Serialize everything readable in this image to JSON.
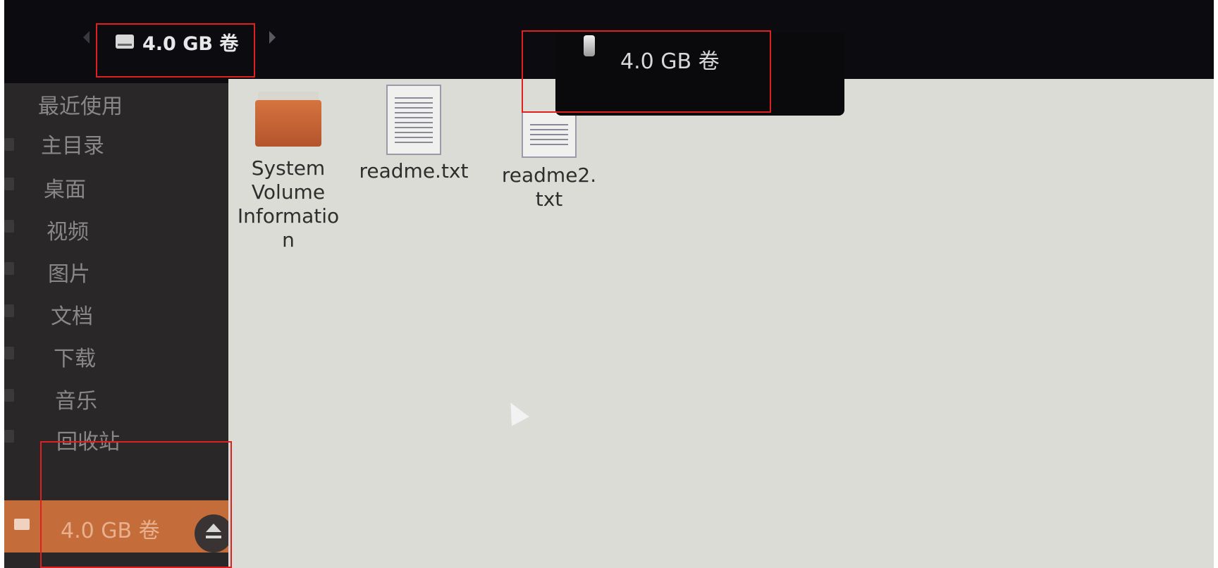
{
  "window": {
    "title": "4.0 GB 卷"
  },
  "header": {
    "path_label": "4.0 GB 卷"
  },
  "tooltip": {
    "label": "4.0 GB 卷"
  },
  "sidebar": {
    "items": [
      {
        "label": "最近使用"
      },
      {
        "label": "主目录"
      },
      {
        "label": "桌面"
      },
      {
        "label": "视频"
      },
      {
        "label": "图片"
      },
      {
        "label": "文档"
      },
      {
        "label": "下载"
      },
      {
        "label": "音乐"
      },
      {
        "label": "回收站"
      }
    ],
    "drive": {
      "label": "4.0 GB 卷",
      "selected": true
    }
  },
  "files": [
    {
      "name": "System Volume Informatio n",
      "type": "folder"
    },
    {
      "name": "readme.txt",
      "type": "text"
    },
    {
      "name": "readme2. txt",
      "type": "text"
    }
  ],
  "colors": {
    "accent": "#c46d3a",
    "annotation": "#e02020",
    "content_bg": "#dcdcd6",
    "sidebar_bg": "#2a2728"
  },
  "icons": [
    "drive-icon",
    "eject-icon",
    "folder-icon",
    "text-file-icon",
    "usb-icon",
    "pointer-cursor"
  ]
}
